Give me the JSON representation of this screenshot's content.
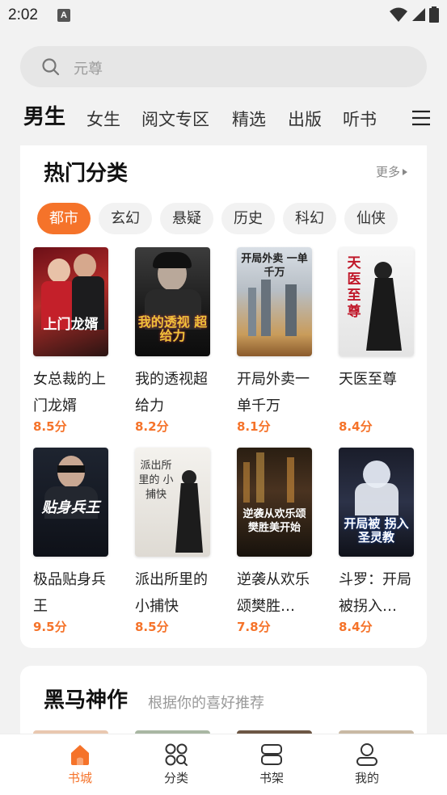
{
  "status": {
    "time": "2:02",
    "notif_letter": "A"
  },
  "search": {
    "placeholder": "元尊"
  },
  "tabs": [
    {
      "label": "男生",
      "active": true
    },
    {
      "label": "女生"
    },
    {
      "label": "阅文专区"
    },
    {
      "label": "精选"
    },
    {
      "label": "出版"
    },
    {
      "label": "听书"
    }
  ],
  "hot": {
    "title": "热门分类",
    "more": "更多",
    "chips": [
      "都市",
      "玄幻",
      "悬疑",
      "历史",
      "科幻",
      "仙侠"
    ],
    "books": [
      {
        "title": "女总裁的上门龙婿",
        "score": "8.5分",
        "cover_text": "上门龙婿"
      },
      {
        "title": "我的透视超给力",
        "score": "8.2分",
        "cover_text": "我的透视 超给力"
      },
      {
        "title": "开局外卖一单千万",
        "score": "8.1分",
        "cover_text": "开局外卖 一单千万"
      },
      {
        "title": "天医至尊",
        "score": "8.4分",
        "cover_text": "天医至尊"
      },
      {
        "title": "极品贴身兵王",
        "score": "9.5分",
        "cover_text": "贴身兵王"
      },
      {
        "title": "派出所里的小捕快",
        "score": "8.5分",
        "cover_text": "派出所里的 小捕快"
      },
      {
        "title": "逆袭从欢乐颂樊胜…",
        "score": "7.8分",
        "cover_text": "逆袭从欢乐颂 樊胜美开始"
      },
      {
        "title": "斗罗：开局被拐入…",
        "score": "8.4分",
        "cover_text": "开局被 拐入圣灵教"
      }
    ]
  },
  "dark": {
    "title": "黑马神作",
    "subtitle": "根据你的喜好推荐"
  },
  "nav": [
    {
      "label": "书城",
      "icon": "home-icon",
      "active": true
    },
    {
      "label": "分类",
      "icon": "category-icon"
    },
    {
      "label": "书架",
      "icon": "bookshelf-icon"
    },
    {
      "label": "我的",
      "icon": "profile-icon"
    }
  ],
  "colors": {
    "accent": "#f5732a"
  }
}
